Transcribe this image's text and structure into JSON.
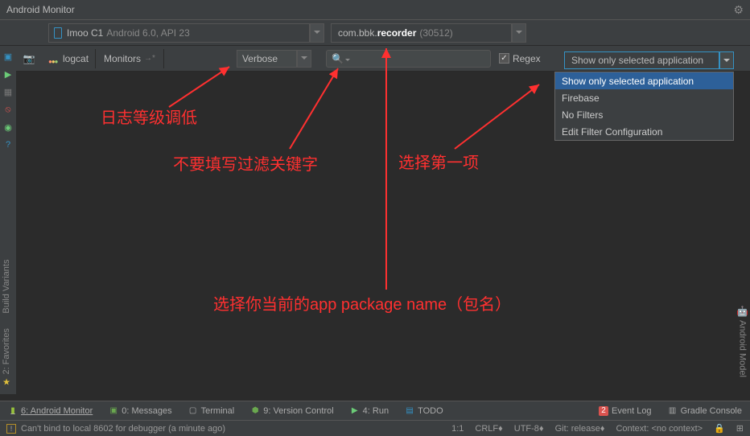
{
  "title": "Android Monitor",
  "header": {
    "device_name": "Imoo C1",
    "device_api": "Android 6.0, API 23",
    "process_prefix": "com.bbk.",
    "process_bold": "recorder",
    "process_pid": "(30512)"
  },
  "toolbar": {
    "logcat_tab": "logcat",
    "monitors_tab": "Monitors",
    "log_level": "Verbose",
    "regex_label": "Regex",
    "regex_checked": true,
    "filter_selected": "Show only selected application"
  },
  "filter_popup": [
    "Show only selected application",
    "Firebase",
    "No Filters",
    "Edit Filter Configuration"
  ],
  "side_labels": {
    "build_variants": "Build Variants",
    "favorites": "2: Favorites",
    "android_model": "Android Model"
  },
  "bottom_tabs": {
    "android_monitor": "6: Android Monitor",
    "messages": "0: Messages",
    "terminal": "Terminal",
    "version_control": "9: Version Control",
    "run": "4: Run",
    "todo": "TODO",
    "event_log": "Event Log",
    "event_log_count": "2",
    "gradle_console": "Gradle Console"
  },
  "status_bar": {
    "message": "Can't bind to local 8602 for debugger (a minute ago)",
    "line_col": "1:1",
    "line_ending": "CRLF",
    "encoding": "UTF-8",
    "git": "Git: release",
    "context": "Context: <no context>"
  },
  "annotations": {
    "log_level": "日志等级调低",
    "no_filter_keyword": "不要填写过滤关键字",
    "select_first": "选择第一项",
    "package_name": "选择你当前的app package name（包名）"
  }
}
